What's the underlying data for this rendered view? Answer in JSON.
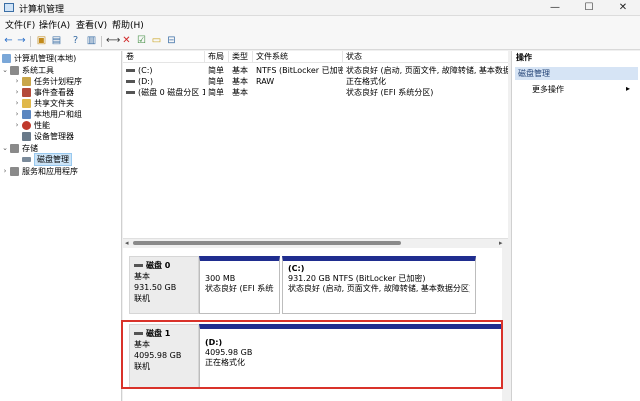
{
  "window": {
    "title": "计算机管理",
    "minimize": "—",
    "maximize": "☐",
    "close": "✕"
  },
  "menu": [
    "文件(F)",
    "操作(A)",
    "查看(V)",
    "帮助(H)"
  ],
  "toolbar": {
    "back": "←",
    "forward": "→",
    "up": "▣",
    "console": "▤",
    "help": "?",
    "props": "▥",
    "connect": "⟷",
    "delete": "✕",
    "check": "☑",
    "folder": "▭",
    "properties": "⊟"
  },
  "tree": {
    "root": "计算机管理(本地)",
    "system_tools": "系统工具",
    "items_tools": [
      "任务计划程序",
      "事件查看器",
      "共享文件夹",
      "本地用户和组",
      "性能",
      "设备管理器"
    ],
    "storage": "存储",
    "disk_mgmt": "磁盘管理",
    "services": "服务和应用程序"
  },
  "list": {
    "columns": [
      "卷",
      "布局",
      "类型",
      "文件系统",
      "状态"
    ],
    "rows": [
      {
        "vol": "(C:)",
        "layout": "简单",
        "type": "基本",
        "fs": "NTFS (BitLocker 已加密)",
        "status": "状态良好 (启动, 页面文件, 故障转储, 基本数据分"
      },
      {
        "vol": "(D:)",
        "layout": "简单",
        "type": "基本",
        "fs": "RAW",
        "status": "正在格式化"
      },
      {
        "vol": "(磁盘 0 磁盘分区 1)",
        "layout": "简单",
        "type": "基本",
        "fs": "",
        "status": "状态良好 (EFI 系统分区)"
      }
    ]
  },
  "disks": [
    {
      "name": "磁盘 0",
      "kind": "基本",
      "size": "931.50 GB",
      "state": "联机",
      "partitions": [
        {
          "label": "",
          "size": "300 MB",
          "status": "状态良好 (EFI 系统分"
        },
        {
          "label": "(C:)",
          "size": "931.20 GB NTFS (BitLocker 已加密)",
          "status": "状态良好 (启动, 页面文件, 故障转储, 基本数据分区)"
        }
      ]
    },
    {
      "name": "磁盘 1",
      "kind": "基本",
      "size": "4095.98 GB",
      "state": "联机",
      "partitions": [
        {
          "label": "(D:)",
          "size": "4095.98 GB",
          "status": "正在格式化"
        }
      ]
    }
  ],
  "actions": {
    "header": "操作",
    "section": "磁盘管理",
    "more": "更多操作",
    "more_arrow": "▸"
  },
  "colors": {
    "partition_bar": "#1f2d8f",
    "highlight": "#d9322a",
    "selection": "#cce4f7"
  }
}
